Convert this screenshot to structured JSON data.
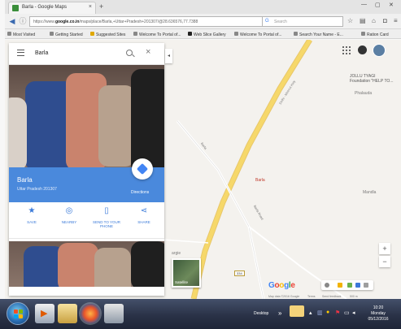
{
  "browser": {
    "tab_title": "Barla - Google Maps",
    "tab_close": "×",
    "new_tab": "+",
    "url_prefix": "https://www.",
    "url_domain": "google.co.in",
    "url_rest": "/maps/place/Barla,+Uttar+Pradesh+201307/@28.636576,77.7388",
    "search_placeholder": "Search",
    "bookmarks": [
      "Most Visited",
      "Getting Started",
      "Suggested Sites",
      "Welcome To Portal of...",
      "Web Slice Gallery",
      "Welcome To Portal of...",
      "Search Your Name - E...",
      "Ration Card"
    ]
  },
  "maps": {
    "search_query": "Barla",
    "place_name": "Barla",
    "place_subtitle": "Uttar Pradesh 201307",
    "directions_label": "Directions",
    "actions": [
      {
        "label": "SAVE",
        "icon": "star-icon"
      },
      {
        "label": "NEARBY",
        "icon": "nearby-icon"
      },
      {
        "label": "SEND TO YOUR PHONE",
        "icon": "phone-icon"
      },
      {
        "label": "SHARE",
        "icon": "share-icon"
      }
    ],
    "collapse_label": "◂",
    "map_labels": {
      "foundation": "JOLLU TYAGI\nFoundation \"HELP TO...",
      "phalauda": "Phalauda",
      "mandla": "Mandla",
      "barla": "Barla",
      "road_a": "Barla",
      "road_b": "Barla Road",
      "highway": "Delhi - Meerut Hwy",
      "pargie": "argie",
      "route_shield": "334"
    },
    "satellite_label": "Satellite",
    "google_logo": [
      "G",
      "o",
      "o",
      "g",
      "l",
      "e"
    ],
    "footer": [
      "Map data ©2016 Google",
      "Terms",
      "Send feedback",
      "500 m"
    ],
    "zoom_in": "+",
    "zoom_out": "−"
  },
  "taskbar": {
    "desktop_label": "Desktop",
    "clock_time": "10:20",
    "clock_day": "Monday",
    "clock_date": "05/12/2016"
  },
  "colors": {
    "accent_blue": "#4a89dc",
    "highway_yellow": "#f6d86a",
    "route_red": "#c0392b"
  }
}
